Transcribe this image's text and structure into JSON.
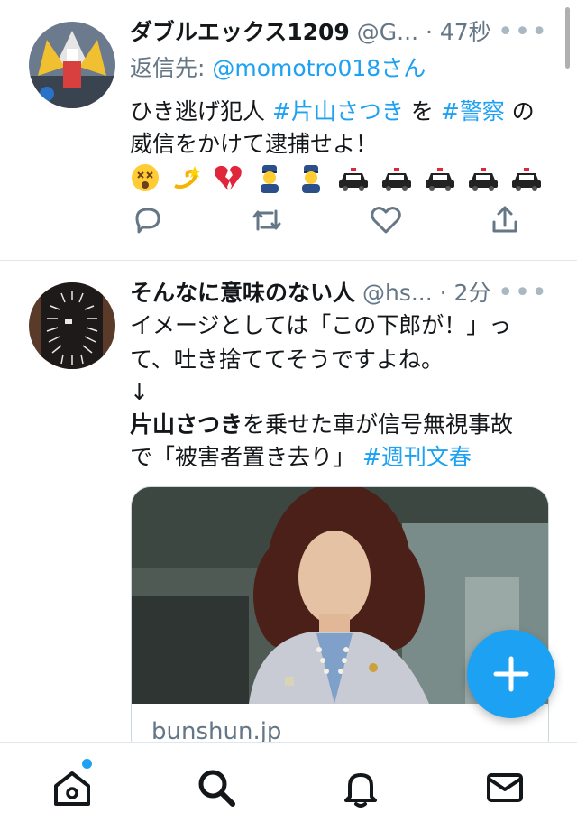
{
  "tweets": [
    {
      "name": "ダブルエックス1209",
      "handle": "@G...",
      "sep": "·",
      "time": "47秒",
      "more": "•••",
      "reply_prefix": "返信先: ",
      "reply_to": "@momotro018さん",
      "line1_a": "ひき逃げ犯人 ",
      "tag1": "#片山さつき",
      "line1_b": " を ",
      "tag2": "#警察",
      "line1_c": " の",
      "line2": "威信をかけて逮捕せよ！",
      "emojis": [
        "dizzy-face",
        "dizzy-symbol",
        "broken-heart",
        "police-officer",
        "police-officer",
        "police-car",
        "police-car",
        "police-car",
        "police-car",
        "police-car"
      ]
    },
    {
      "name": "そんなに意味のない人",
      "handle": "@hs...",
      "sep": "·",
      "time": "2分",
      "more": "•••",
      "line1": "イメージとしては「この下郎が！」っ",
      "line2": "て、吐き捨ててそうですよね。",
      "line3": "↓",
      "line4_bold": "片山さつき",
      "line4_rest": "を乗せた車が信号無視事故",
      "line5_a": "で「被害者置き去り」 ",
      "tag": "#週刊文春",
      "card_domain": "bunshun.jp"
    }
  ],
  "colors": {
    "accent": "#1da1f2",
    "secondary": "#657786",
    "divider": "#e1e8ed"
  },
  "tabs": [
    "home-icon",
    "search-icon",
    "notifications-icon",
    "messages-icon"
  ]
}
